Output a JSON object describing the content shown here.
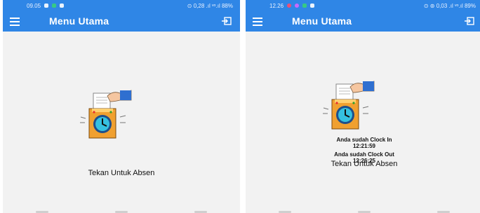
{
  "screens": [
    {
      "status_time": "09.05",
      "status_right": "⊙ 0,28 .ıl ᵛᵒ.ıl 88%",
      "app_title": "Menu Utama",
      "action_label": "Tekan Untuk Absen"
    },
    {
      "status_time": "12.26",
      "status_right": "⊙ ⊚ 0,03 .ıl ᵛᵒ.ıl 89%",
      "app_title": "Menu Utama",
      "action_label": "Tekan Untuk Absen",
      "clock_in_label": "Anda sudah Clock In",
      "clock_in_time": "12:21:59",
      "clock_out_label": "Anda sudah Clock Out",
      "clock_out_time": "12:26:25"
    }
  ],
  "icons": {
    "menu": "hamburger-icon",
    "logout": "logout-icon",
    "attendance": "time-clock-illustration"
  },
  "colors": {
    "appbar": "#2f86e6",
    "background": "#f2f2f2",
    "text": "#111111"
  }
}
